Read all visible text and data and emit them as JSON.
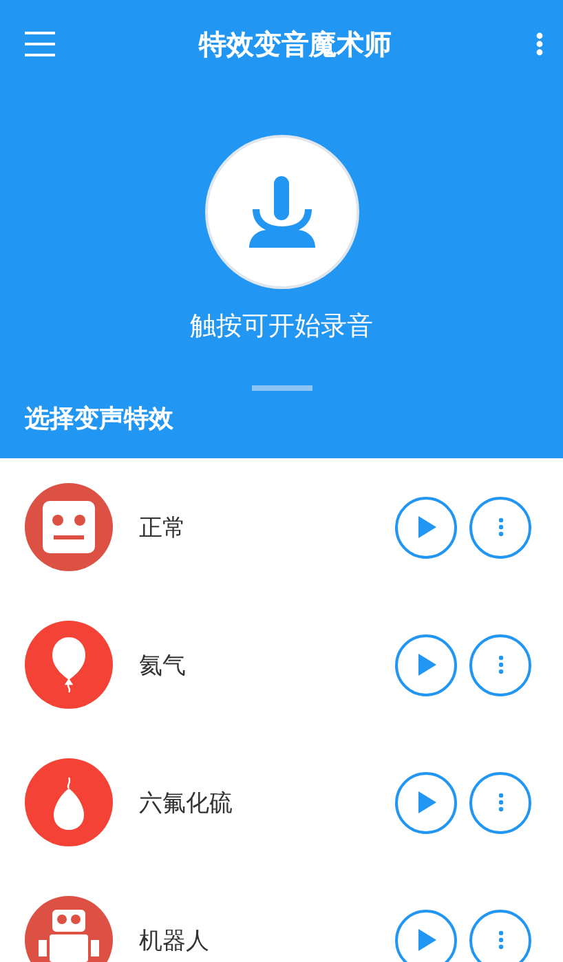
{
  "app_bar": {
    "title": "特效变音魔术师"
  },
  "record": {
    "hint": "触按可开始录音"
  },
  "section_title": "选择变声特效",
  "effects": [
    {
      "kind": "face",
      "name": "正常"
    },
    {
      "kind": "balloon",
      "name": "氦气"
    },
    {
      "kind": "heavy-balloon",
      "name": "六氟化硫"
    },
    {
      "kind": "robot",
      "name": "机器人"
    }
  ]
}
